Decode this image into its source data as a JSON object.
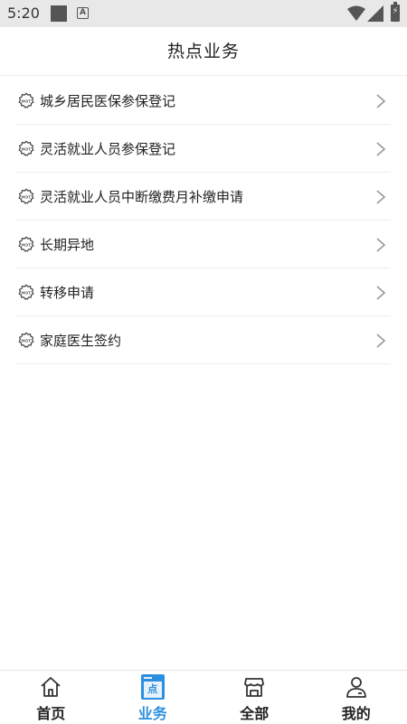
{
  "status_bar": {
    "time": "5:20",
    "a_badge": "A"
  },
  "header": {
    "title": "热点业务"
  },
  "list": {
    "items": [
      {
        "label": "城乡居民医保参保登记"
      },
      {
        "label": "灵活就业人员参保登记"
      },
      {
        "label": "灵活就业人员中断缴费月补缴申请"
      },
      {
        "label": "长期异地"
      },
      {
        "label": "转移申请"
      },
      {
        "label": "家庭医生签约"
      }
    ]
  },
  "tabbar": {
    "tabs": [
      {
        "label": "首页",
        "icon": "home-icon",
        "active": false
      },
      {
        "label": "业务",
        "icon": "business-icon",
        "active": true
      },
      {
        "label": "全部",
        "icon": "store-icon",
        "active": false
      },
      {
        "label": "我的",
        "icon": "user-icon",
        "active": false
      }
    ],
    "business_icon_text": "点"
  },
  "colors": {
    "accent": "#2b8fe0",
    "divider": "#ececec",
    "status_bar": "#e8e8e8"
  }
}
